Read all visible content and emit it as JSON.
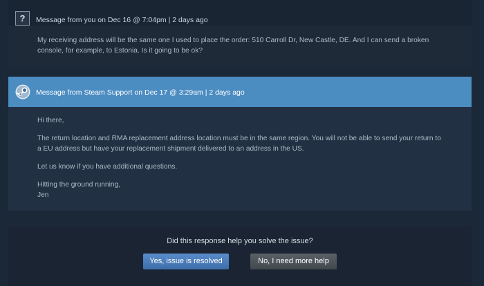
{
  "messages": [
    {
      "author_line": "Message from you on Dec 16 @ 7:04pm | 2 days ago",
      "avatar_icon": "question-mark-icon",
      "avatar_glyph": "?",
      "paragraphs": [
        "My receiving address will be the same one I used to place the order: 510 Carroll Dr, New Castle, DE. And I can send a broken console, for example, to Estonia. Is it going to be ok?"
      ]
    },
    {
      "author_line": "Message from Steam Support on Dec 17 @ 3:29am | 2 days ago",
      "avatar_icon": "steam-logo-icon",
      "header_color": "#4b8cc1",
      "paragraphs": [
        "Hi there,",
        "The return location and RMA replacement address location must be in the same region. You will not be able to send your return to a EU address but have your replacement shipment delivered to an address in the US.",
        "Let us know if you have additional questions.",
        "Hitting the ground running,",
        "Jen"
      ]
    }
  ],
  "feedback": {
    "question": "Did this response help you solve the issue?",
    "yes_label": "Yes, issue is resolved",
    "no_label": "No, I need more help"
  }
}
